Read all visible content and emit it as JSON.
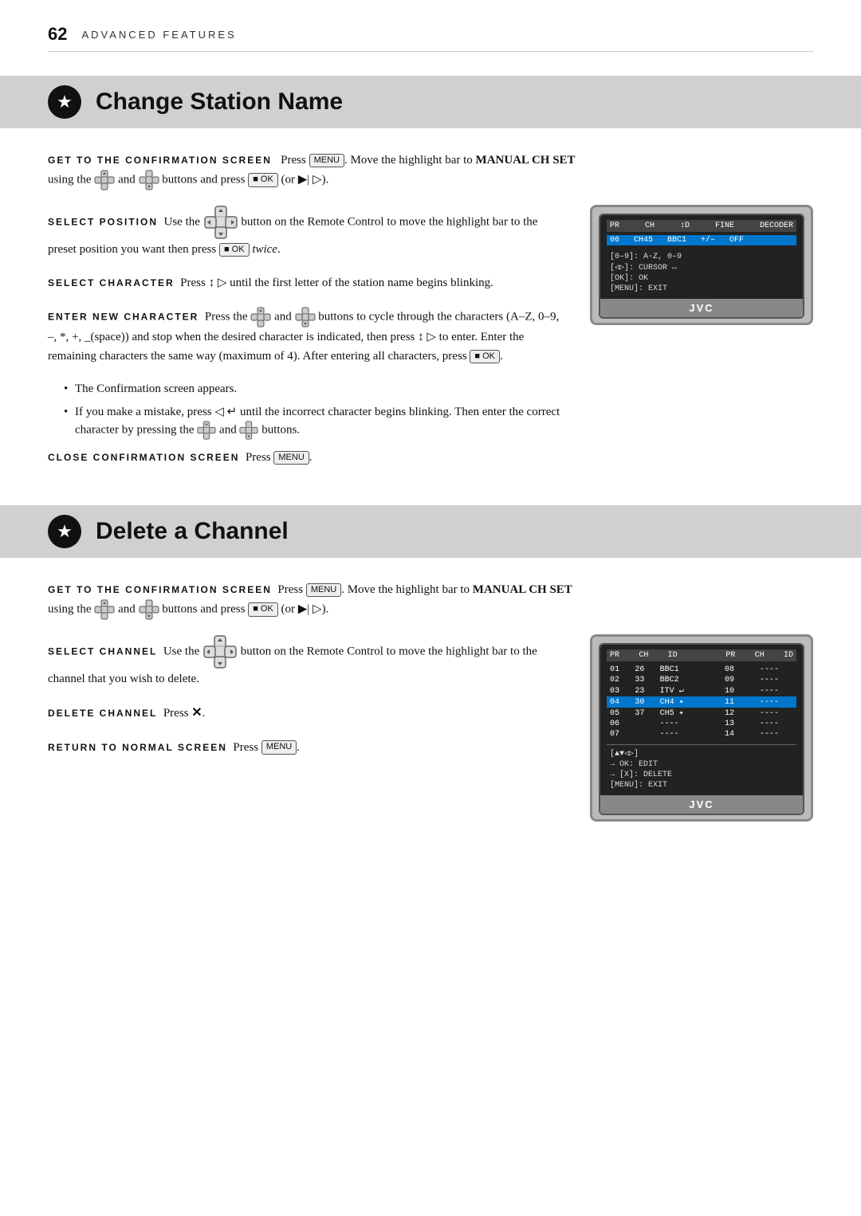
{
  "page": {
    "number": "62",
    "chapter": "ADVANCED FEATURES"
  },
  "section1": {
    "title": "Change Station Name",
    "star": "★",
    "steps": {
      "get_to_screen": {
        "label": "GET TO THE CONFIRMATION SCREEN",
        "text": "Press",
        "button_menu": "MENU",
        "text2": ". Move the highlight bar to",
        "bold_target": "MANUAL CH SET",
        "text3": "using the",
        "button_up": "▲",
        "text_and": "and",
        "button_down": "▼",
        "text4": "buttons and press",
        "button_ok": "■ OK",
        "text5": "(or",
        "button_right": "▶| ▷",
        "text6": ")."
      },
      "select_position": {
        "label": "SELECT POSITION",
        "text1": "Use the",
        "text2": "button on the Remote Control to move the highlight bar to the preset position you want then press",
        "button_ok": "■ OK",
        "text3": "twice."
      },
      "select_character": {
        "label": "SELECT CHARACTER",
        "text": "Press ↕ ▷ until the first letter of the station name begins blinking."
      },
      "enter_new_character": {
        "label": "ENTER NEW CHARACTER",
        "text": "Press the",
        "button_up2": "▲",
        "text_and2": "and",
        "button_down2": "▼",
        "text2": "buttons to cycle through the characters (A–Z, 0–9, –, *, +, _(space)) and stop when the desired character is indicated, then press ↕ ▷ to enter. Enter the remaining characters the same way (maximum of 4). After entering all characters, press",
        "button_ok2": "■ OK",
        "text3": "."
      },
      "bullet1": "The Confirmation screen appears.",
      "bullet2": "If you make a mistake, press ◁ ↵ until the incorrect character begins blinking. Then enter the correct character by pressing the",
      "bullet2b": "and",
      "bullet2c": "buttons.",
      "close_screen": {
        "label": "CLOSE CONFIRMATION SCREEN",
        "text": "Press",
        "button_menu": "MENU",
        "text2": "."
      }
    },
    "tv_display": {
      "header": [
        "PR",
        "CH",
        "↕D",
        "FINE",
        "DECODER"
      ],
      "highlight_row": [
        "06",
        "CH45",
        "BBC1",
        "+/–",
        "OFF"
      ],
      "info": [
        "[0–9]: A-Z, 0–9",
        "[◁▷]: CURSOR ↔",
        "[OK]: OK",
        "[MENU]: EXIT"
      ],
      "brand": "JVC"
    }
  },
  "section2": {
    "title": "Delete a Channel",
    "star": "★",
    "steps": {
      "get_to_screen": {
        "label": "GET TO THE CONFIRMATION SCREEN",
        "text": "Press",
        "button_menu": "MENU",
        "text2": ". Move the highlight bar to",
        "bold_target": "MANUAL CH SET",
        "text3": "using the",
        "text4": "buttons and press",
        "button_ok": "■ OK",
        "text5": "(or",
        "button_right": "▶| ▷",
        "text6": ")."
      },
      "select_channel": {
        "label": "SELECT CHANNEL",
        "text1": "Use the",
        "text2": "button on the Remote Control to move the highlight bar to the channel that you wish to delete."
      },
      "delete_channel": {
        "label": "DELETE CHANNEL",
        "text": "Press",
        "button_x": "✕",
        "text2": "."
      },
      "return_screen": {
        "label": "RETURN TO NORMAL SCREEN",
        "text": "Press",
        "button_menu": "MENU",
        "text2": "."
      }
    },
    "tv_display": {
      "headers1": [
        "PR",
        "CH",
        "ID"
      ],
      "headers2": [
        "PR",
        "CH",
        "ID"
      ],
      "rows": [
        {
          "pr": "01",
          "ch": "26",
          "id": "BBC1",
          "pr2": "08",
          "ch2": "",
          "id2": "----"
        },
        {
          "pr": "02",
          "ch": "33",
          "id": "BBC2",
          "pr2": "09",
          "ch2": "",
          "id2": "----"
        },
        {
          "pr": "03",
          "ch": "23",
          "id": "ITV ↵",
          "pr2": "10",
          "ch2": "",
          "id2": "----"
        },
        {
          "pr": "04",
          "ch": "30",
          "id": "CH4 ✦",
          "pr2": "11",
          "ch2": "",
          "id2": "----",
          "highlight": true
        },
        {
          "pr": "05",
          "ch": "37",
          "id": "CH5 ✦",
          "pr2": "12",
          "ch2": "",
          "id2": "----"
        },
        {
          "pr": "06",
          "ch": "",
          "id": "----",
          "pr2": "13",
          "ch2": "",
          "id2": "----"
        },
        {
          "pr": "07",
          "ch": "",
          "id": "----",
          "pr2": "14",
          "ch2": "",
          "id2": "----"
        }
      ],
      "nav_hints": [
        "[▲▼◁▷]",
        "→ OK: EDIT",
        "→ [X]: DELETE",
        "[MENU]: EXIT"
      ],
      "brand": "JVC"
    }
  }
}
